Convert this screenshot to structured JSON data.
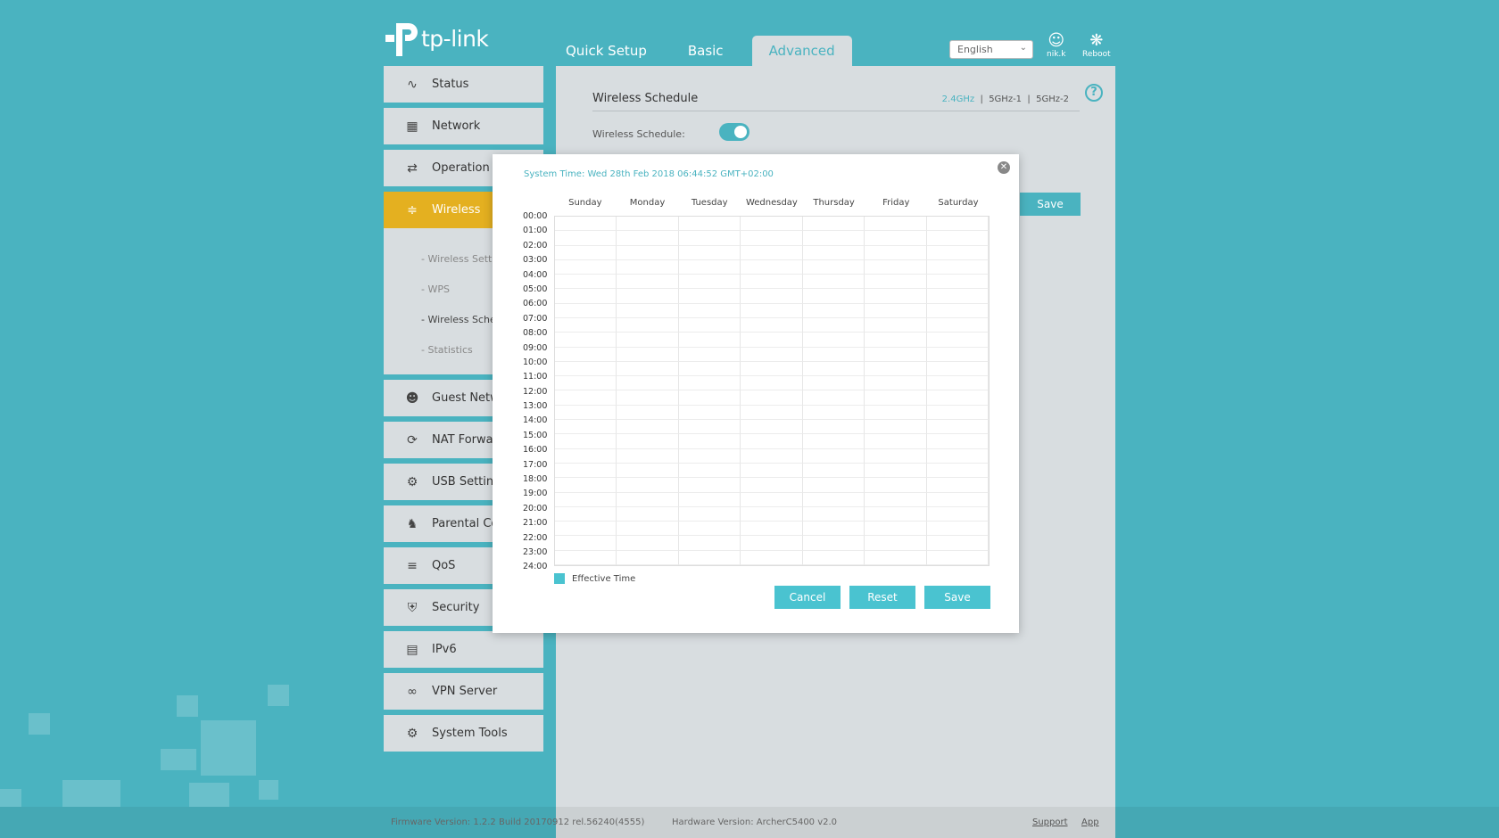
{
  "header": {
    "brand": "tp-link",
    "tabs": [
      {
        "label": "Quick Setup"
      },
      {
        "label": "Basic"
      },
      {
        "label": "Advanced"
      }
    ],
    "language": "English",
    "user_label": "nik.k",
    "reboot_label": "Reboot"
  },
  "sidebar": {
    "items": [
      {
        "label": "Status",
        "icon": "pulse-icon"
      },
      {
        "label": "Network",
        "icon": "network-icon"
      },
      {
        "label": "Operation M",
        "icon": "loop-icon"
      },
      {
        "label": "Wireless",
        "icon": "wifi-icon"
      },
      {
        "label": "Guest Netwo",
        "icon": "users-icon"
      },
      {
        "label": "NAT Forwar",
        "icon": "nat-icon"
      },
      {
        "label": "USB Setting",
        "icon": "usb-icon"
      },
      {
        "label": "Parental Cor",
        "icon": "family-icon"
      },
      {
        "label": "QoS",
        "icon": "qos-icon"
      },
      {
        "label": "Security",
        "icon": "shield-icon"
      },
      {
        "label": "IPv6",
        "icon": "ipv6-icon"
      },
      {
        "label": "VPN Server",
        "icon": "link-icon"
      },
      {
        "label": "System Tools",
        "icon": "gear-icon"
      }
    ],
    "wireless_sub": [
      {
        "label": "- Wireless Setti"
      },
      {
        "label": "- WPS"
      },
      {
        "label": "- Wireless Sche"
      },
      {
        "label": "- Statistics"
      }
    ]
  },
  "main": {
    "title": "Wireless Schedule",
    "bands": [
      "2.4GHz",
      "5GHz-1",
      "5GHz-2"
    ],
    "band_sep": "|",
    "schedule_label": "Wireless Schedule:",
    "schedule_enabled": true,
    "save_label": "Save"
  },
  "modal": {
    "system_time": "System Time: Wed 28th Feb 2018 06:44:52 GMT+02:00",
    "days": [
      "Sunday",
      "Monday",
      "Tuesday",
      "Wednesday",
      "Thursday",
      "Friday",
      "Saturday"
    ],
    "hours": [
      "00:00",
      "01:00",
      "02:00",
      "03:00",
      "04:00",
      "05:00",
      "06:00",
      "07:00",
      "08:00",
      "09:00",
      "10:00",
      "11:00",
      "12:00",
      "13:00",
      "14:00",
      "15:00",
      "16:00",
      "17:00",
      "18:00",
      "19:00",
      "20:00",
      "21:00",
      "22:00",
      "23:00",
      "24:00"
    ],
    "legend_label": "Effective Time",
    "cancel_label": "Cancel",
    "reset_label": "Reset",
    "save_label": "Save"
  },
  "footer": {
    "firmware": "Firmware Version: 1.2.2 Build 20170912 rel.56240(4555)",
    "hardware": "Hardware Version: ArcherC5400 v2.0",
    "support": "Support",
    "app": "App"
  },
  "colors": {
    "background": "#4ab3c0",
    "accent": "#4ac3d0",
    "active_menu": "#e4b020",
    "panel": "#d8dde0"
  }
}
